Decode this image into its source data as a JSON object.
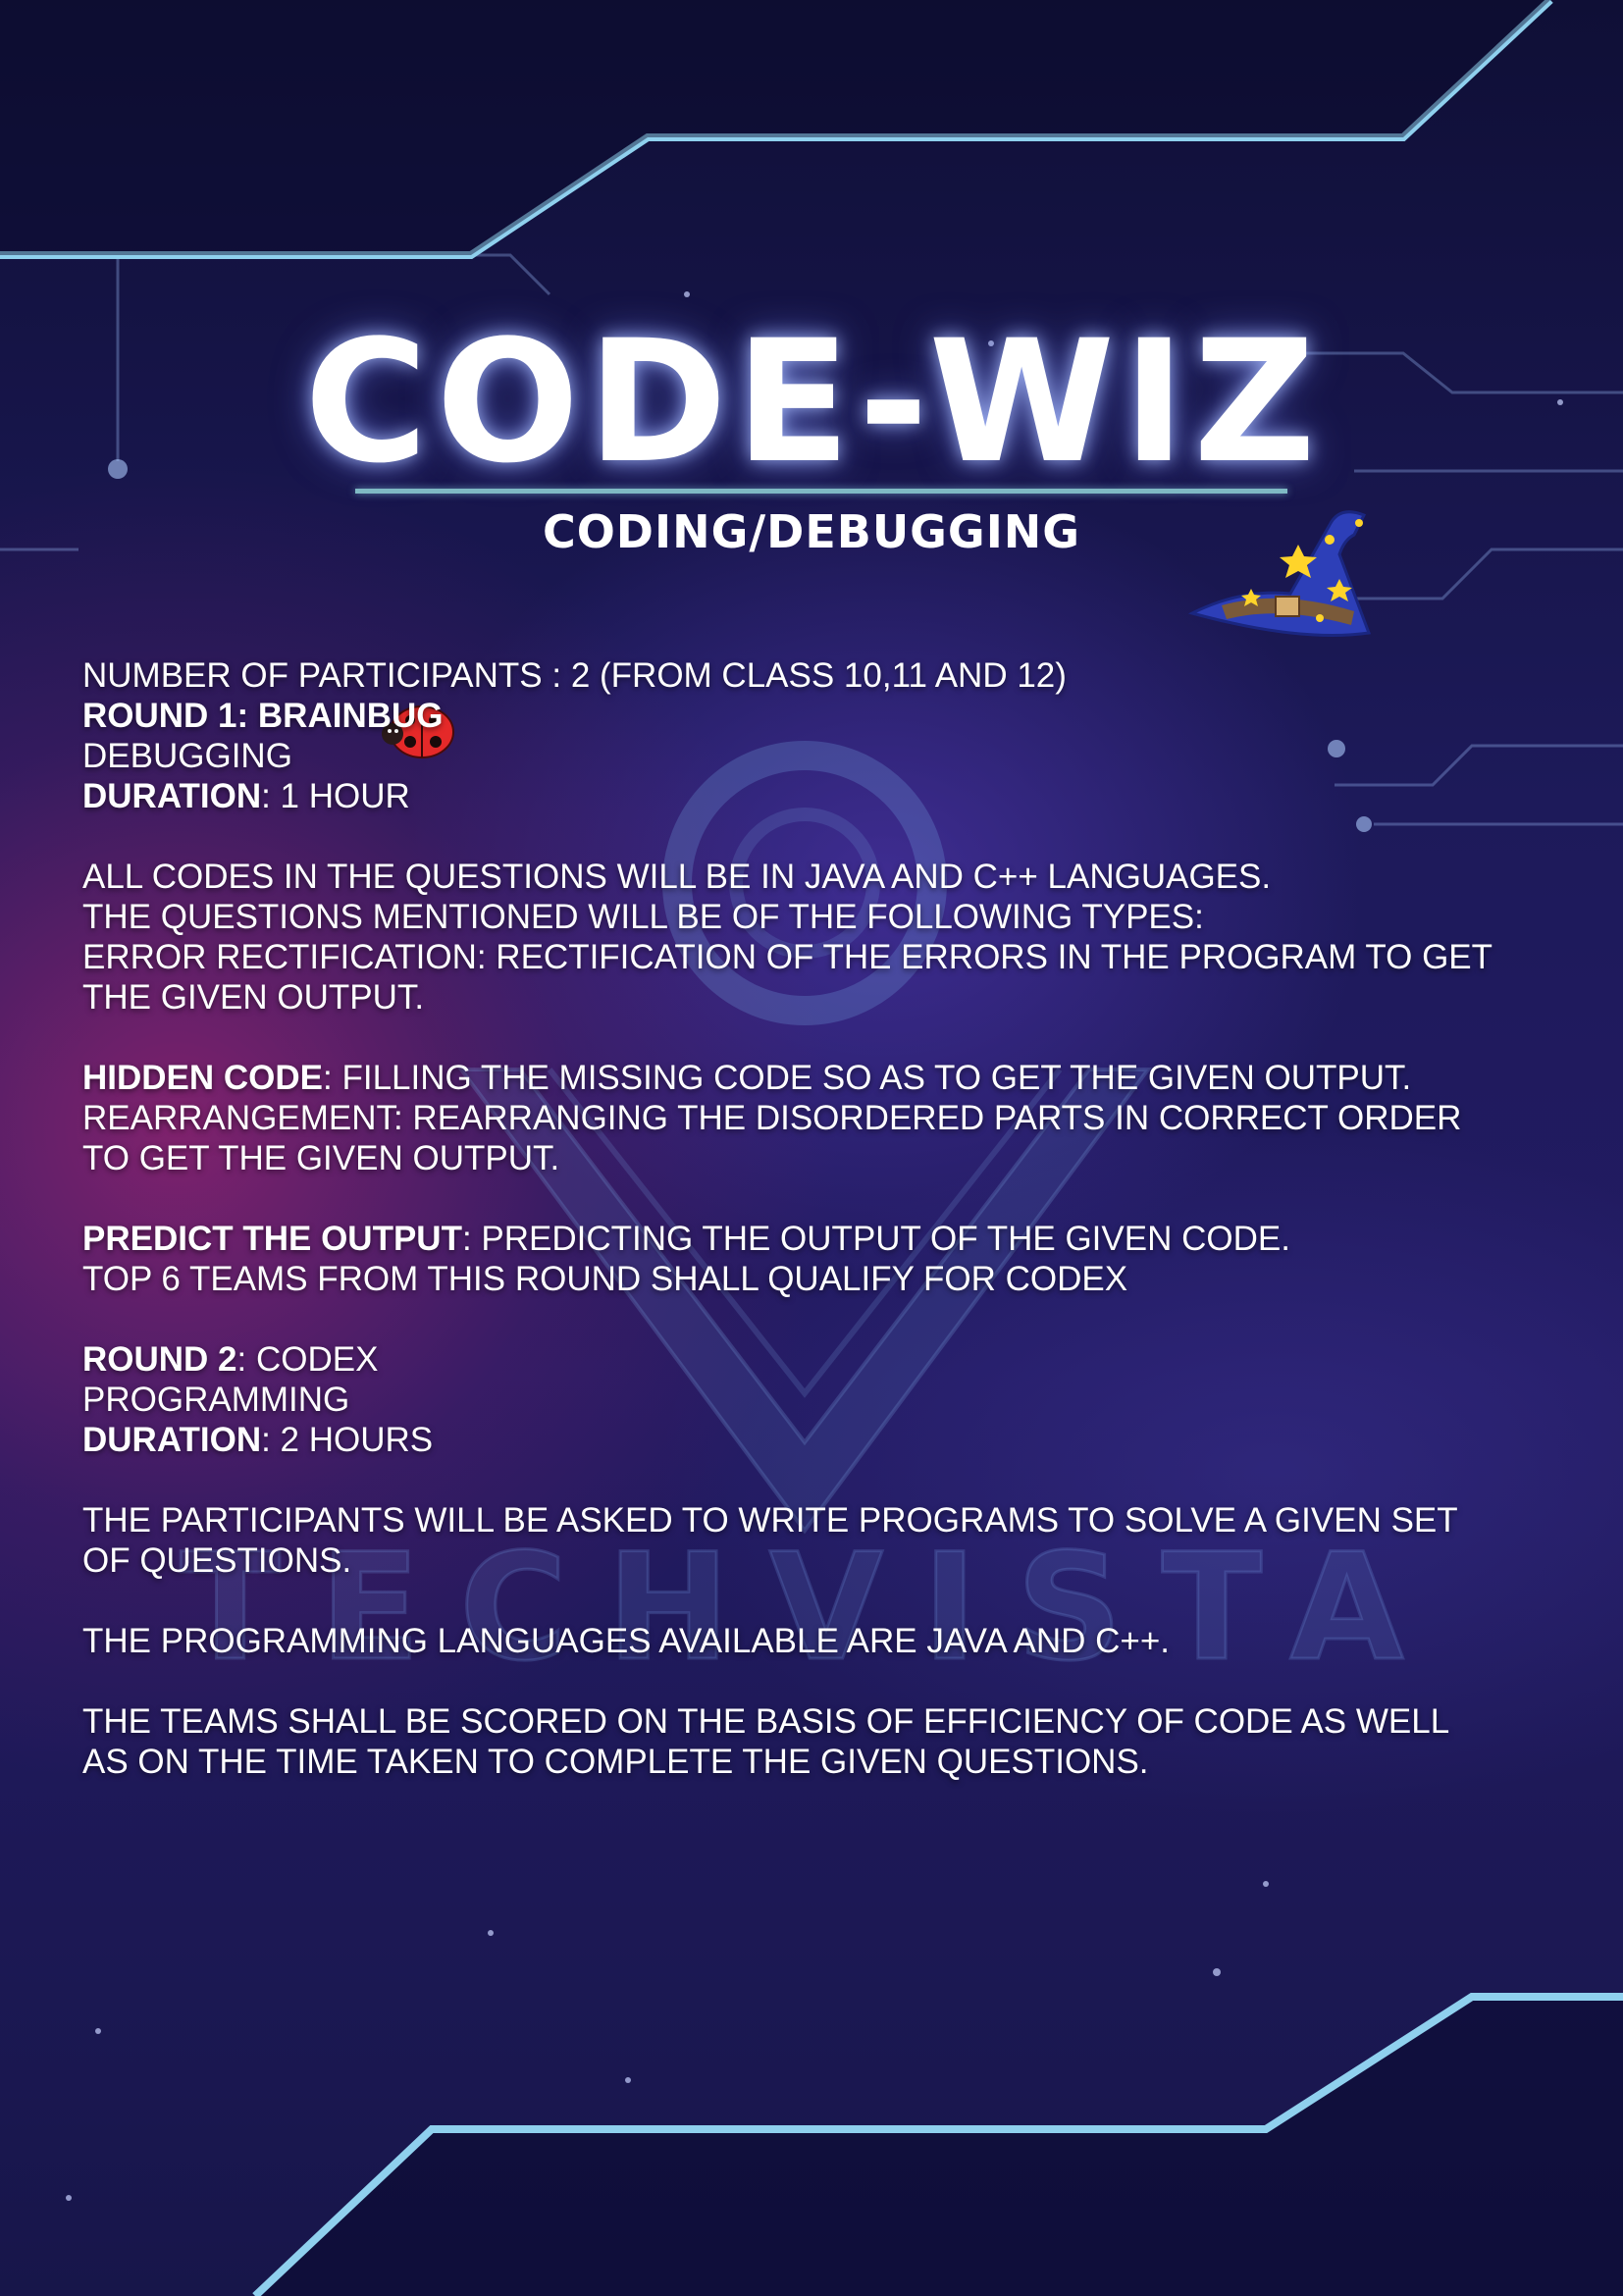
{
  "event": {
    "title": "CODE-WIZ",
    "subtitle": "CODING/DEBUGGING",
    "watermark": "TECHVISTA"
  },
  "info": {
    "participants": "NUMBER OF PARTICIPANTS : 2 (FROM CLASS 10,11 AND 12)"
  },
  "round1": {
    "heading": "ROUND 1: BRAINBUG",
    "type": "DEBUGGING",
    "duration_label": "DURATION",
    "duration_value": ": 1 HOUR",
    "para1": [
      "ALL CODES IN THE QUESTIONS WILL BE IN JAVA AND C++ LANGUAGES.",
      "THE QUESTIONS MENTIONED WILL BE OF THE FOLLOWING TYPES:",
      "ERROR RECTIFICATION: RECTIFICATION OF THE ERRORS IN THE PROGRAM TO GET",
      "THE GIVEN OUTPUT."
    ],
    "hidden_label": "HIDDEN CODE",
    "hidden_text": ": FILLING THE MISSING CODE SO AS TO GET THE GIVEN OUTPUT.",
    "rearrange": [
      "REARRANGEMENT: REARRANGING THE DISORDERED PARTS IN CORRECT ORDER",
      "TO GET THE GIVEN OUTPUT."
    ],
    "predict_label": "PREDICT THE OUTPUT",
    "predict_text": ": PREDICTING THE OUTPUT OF THE GIVEN CODE.",
    "qualify": "TOP 6 TEAMS FROM THIS ROUND SHALL QUALIFY FOR CODEX"
  },
  "round2": {
    "heading_label": "ROUND 2",
    "heading_value": ": CODEX",
    "type": "PROGRAMMING",
    "duration_label": "DURATION",
    "duration_value": ": 2 HOURS",
    "para1": [
      "THE PARTICIPANTS WILL BE ASKED TO WRITE PROGRAMS TO SOLVE A GIVEN SET",
      "OF QUESTIONS."
    ],
    "languages": "THE PROGRAMMING LANGUAGES AVAILABLE ARE JAVA AND C++.",
    "scoring": [
      "THE TEAMS SHALL BE SCORED ON THE BASIS OF EFFICIENCY OF CODE AS WELL",
      "AS ON THE TIME TAKEN TO COMPLETE THE GIVEN QUESTIONS."
    ]
  },
  "colors": {
    "background": "#14133f",
    "accent_line": "#8fd0ee",
    "glow": "#aabeff",
    "text": "#ffffff"
  },
  "icons": [
    "wizard-hat-icon",
    "ladybug-icon"
  ]
}
